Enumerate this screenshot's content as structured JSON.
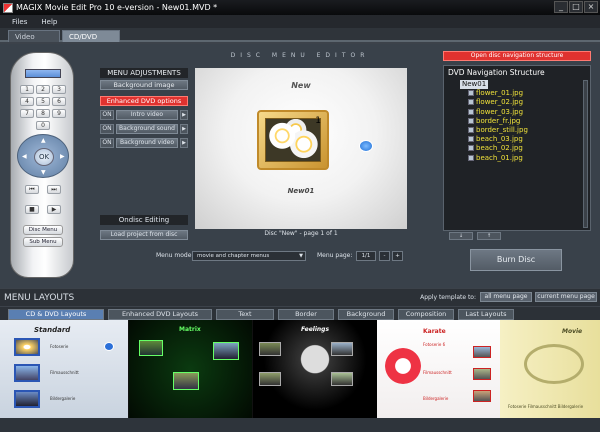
{
  "window": {
    "title": "MAGIX Movie Edit Pro 10 e-version - New01.MVD *",
    "min": "_",
    "max": "□",
    "close": "×"
  },
  "menu": {
    "files": "Files",
    "help": "Help"
  },
  "tabs": {
    "video_editor": "Video Editor",
    "cd_dvd_editor": "CD/DVD Editor"
  },
  "remote": {
    "keys": [
      "1",
      "2",
      "3",
      "4",
      "5",
      "6",
      "7",
      "8",
      "9",
      "0"
    ],
    "ok": "OK",
    "disc_menu": "Disc Menu",
    "sub_menu": "Sub Menu",
    "prev": "⏮",
    "next": "⏭",
    "stop": "■",
    "play": "▶"
  },
  "disc_menu_editor": {
    "title": "DISC MENU EDITOR"
  },
  "menu_adjustments": {
    "header": "MENU ADJUSTMENTS",
    "background_image": "Background image",
    "enhanced_options": "Enhanced DVD options",
    "options": [
      {
        "state": "ON",
        "label": "Intro video"
      },
      {
        "state": "ON",
        "label": "Background sound"
      },
      {
        "state": "ON",
        "label": "Background video"
      }
    ],
    "ondisc_editing": "Ondisc Editing",
    "load_project": "Load project from disc"
  },
  "preview": {
    "title": "New",
    "subtitle": "New01",
    "badge": "1",
    "caption": "Disc \"New\" - page 1 of 1"
  },
  "menu_mode": {
    "label": "Menu mode:",
    "value": "movie and chapter menus",
    "page_label": "Menu page:",
    "page_value": "1/1",
    "minus": "-",
    "plus": "+"
  },
  "navigation": {
    "open_button": "Open disc navigation structure",
    "title": "DVD Navigation Structure",
    "root": "New01",
    "items": [
      "flower_01.jpg",
      "flower_02.jpg",
      "flower_03.jpg",
      "border_fr.jpg",
      "border_still.jpg",
      "beach_03.jpg",
      "beach_02.jpg",
      "beach_01.jpg"
    ],
    "down": "↓",
    "up": "↑"
  },
  "burn": {
    "label": "Burn Disc"
  },
  "menu_layouts": {
    "title": "MENU LAYOUTS",
    "apply_label": "Apply template to:",
    "all_pages": "all menu page",
    "current_page": "current menu page",
    "tabs": [
      "CD & DVD Layouts",
      "Enhanced DVD Layouts",
      "Text",
      "Border",
      "Background",
      "Composition",
      "Last Layouts"
    ],
    "thumbs": [
      "Standard",
      "Matrix",
      "Feelings",
      "Karate",
      "Movie"
    ],
    "thumb_texts": {
      "standard": [
        "Fotoserie",
        "Filmausschnitt",
        "Bildergalerie"
      ],
      "karate": [
        "Fotoserie 6",
        "Filmausschnitt",
        "Bildergalerie"
      ],
      "movie": "Fotoserie  Filmausschnitt  Bildergalerie"
    }
  },
  "colors": {
    "accent_red": "#e0322f",
    "tree_text": "#f0e23a",
    "active_tab": "#5a7fb2"
  }
}
